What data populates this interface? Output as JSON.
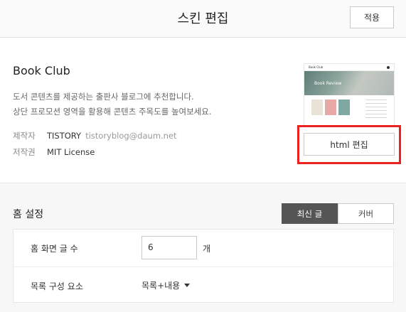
{
  "header": {
    "title": "스킨 편집",
    "apply_label": "적용"
  },
  "skin": {
    "name": "Book Club",
    "description_line1": "도서 콘텐츠를 제공하는 출판사 블로그에 추천합니다.",
    "description_line2": "상단 프로모션 영역을 활용해 콘텐츠 주목도를 높여보세요.",
    "author_label": "제작자",
    "author_name": "TISTORY",
    "author_email": "tistoryblog@daum.net",
    "license_label": "저작권",
    "license_value": "MIT License",
    "thumbnail": {
      "site_title": "Book Club",
      "hero_text": "Book Review"
    },
    "html_edit_label": "html 편집"
  },
  "home": {
    "title": "홈 설정",
    "tabs": [
      {
        "label": "최신 글",
        "active": true
      },
      {
        "label": "커버",
        "active": false
      }
    ],
    "post_count_label": "홈 화면 글 수",
    "post_count_value": "6",
    "post_count_unit": "개",
    "list_component_label": "목록 구성 요소",
    "list_component_value": "목록+내용"
  },
  "colors": {
    "highlight": "#ee2121",
    "active_tab": "#555555"
  }
}
